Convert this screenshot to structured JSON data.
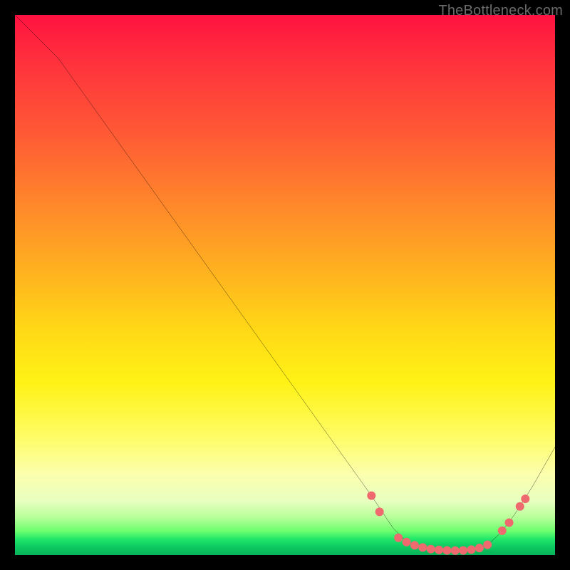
{
  "watermark": "TheBottleneck.com",
  "chart_data": {
    "type": "line",
    "title": "",
    "xlabel": "",
    "ylabel": "",
    "xlim": [
      0,
      100
    ],
    "ylim": [
      0,
      100
    ],
    "grid": false,
    "legend": false,
    "background": "vertical-rainbow red→yellow→green",
    "series": [
      {
        "name": "bottleneck-curve",
        "color": "#000000",
        "x": [
          0,
          8,
          66,
          70,
          72,
          74,
          76,
          78,
          80,
          82,
          84,
          86,
          88,
          90,
          91,
          92.5,
          94,
          96,
          98,
          100
        ],
        "values": [
          100,
          92,
          11,
          5,
          3,
          1.8,
          1.2,
          0.9,
          0.8,
          0.8,
          0.9,
          1.3,
          2.3,
          4.2,
          5.5,
          7.5,
          9.8,
          13,
          16.5,
          20
        ]
      }
    ],
    "markers": [
      {
        "name": "highlight-dots",
        "color": "#ef6a6f",
        "radius_px": 6,
        "points": [
          {
            "x": 66,
            "y": 11
          },
          {
            "x": 67.5,
            "y": 8
          },
          {
            "x": 71,
            "y": 3.2
          },
          {
            "x": 72.5,
            "y": 2.4
          },
          {
            "x": 74,
            "y": 1.8
          },
          {
            "x": 75.5,
            "y": 1.4
          },
          {
            "x": 77,
            "y": 1.1
          },
          {
            "x": 78.5,
            "y": 0.95
          },
          {
            "x": 80,
            "y": 0.85
          },
          {
            "x": 81.5,
            "y": 0.82
          },
          {
            "x": 83,
            "y": 0.85
          },
          {
            "x": 84.5,
            "y": 1.0
          },
          {
            "x": 86,
            "y": 1.3
          },
          {
            "x": 87.5,
            "y": 1.9
          },
          {
            "x": 90.2,
            "y": 4.5
          },
          {
            "x": 91.5,
            "y": 6.0
          },
          {
            "x": 93.5,
            "y": 9.0
          },
          {
            "x": 94.5,
            "y": 10.4
          }
        ]
      }
    ]
  }
}
